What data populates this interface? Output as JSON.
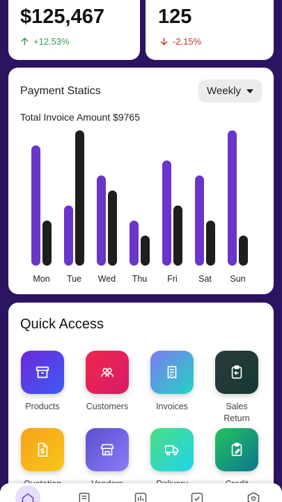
{
  "colors": {
    "background": "#2b1560",
    "accent_purple": "#6a35c9",
    "bar_dark": "#1e1e1e",
    "positive": "#3a9b55",
    "negative": "#c0392b"
  },
  "stats": [
    {
      "value": "$125,467",
      "change": "+12.53%",
      "trend": "up",
      "icon": "arrow-up-icon"
    },
    {
      "value": "125",
      "change": "-2.15%",
      "trend": "down",
      "icon": "arrow-down-icon"
    }
  ],
  "payment": {
    "title": "Payment Statics",
    "period_selected": "Weekly",
    "total_label": "Total Invoice Amount $9765"
  },
  "chart_data": {
    "type": "bar",
    "categories": [
      "Mon",
      "Tue",
      "Wed",
      "Thu",
      "Fri",
      "Sat",
      "Sun"
    ],
    "series": [
      {
        "values": [
          8,
          4,
          6,
          3,
          7,
          6,
          9
        ],
        "color": "#6a35c9"
      },
      {
        "values": [
          3,
          9,
          5,
          2,
          4,
          3,
          2
        ],
        "color": "#1e1e1e"
      }
    ],
    "ylim": [
      0,
      9
    ],
    "grid": false,
    "legend": "none"
  },
  "quick_access": {
    "title": "Quick Access",
    "items": [
      {
        "label": "Products",
        "icon": "archive-box-icon",
        "grad_from": "#6d28d9",
        "grad_to": "#3b5bf5"
      },
      {
        "label": "Customers",
        "icon": "users-icon",
        "grad_from": "#f0264a",
        "grad_to": "#d81b6a"
      },
      {
        "label": "Invoices",
        "icon": "receipt-icon",
        "grad_from": "#7c7cf0",
        "grad_to": "#22d3c5"
      },
      {
        "label": "Sales Return",
        "icon": "return-clipboard-icon",
        "grad_from": "#2b3a3a",
        "grad_to": "#143a35"
      },
      {
        "label": "Quotation",
        "icon": "dollar-document-icon",
        "grad_from": "#f7a21b",
        "grad_to": "#f7c71b"
      },
      {
        "label": "Vendors",
        "icon": "store-icon",
        "grad_from": "#5b4fd1",
        "grad_to": "#8a7cf5"
      },
      {
        "label": "Delivery",
        "icon": "truck-icon",
        "grad_from": "#4ade80",
        "grad_to": "#22d3ee"
      },
      {
        "label": "Credit",
        "icon": "edit-clipboard-icon",
        "grad_from": "#22c55e",
        "grad_to": "#0e7490"
      }
    ]
  },
  "nav": [
    {
      "name": "home",
      "icon": "home-icon",
      "active": true
    },
    {
      "name": "documents",
      "icon": "document-icon",
      "active": false
    },
    {
      "name": "reports",
      "icon": "bar-chart-icon",
      "active": false
    },
    {
      "name": "tasks",
      "icon": "check-square-icon",
      "active": false
    },
    {
      "name": "settings",
      "icon": "hexagon-icon",
      "active": false
    }
  ]
}
